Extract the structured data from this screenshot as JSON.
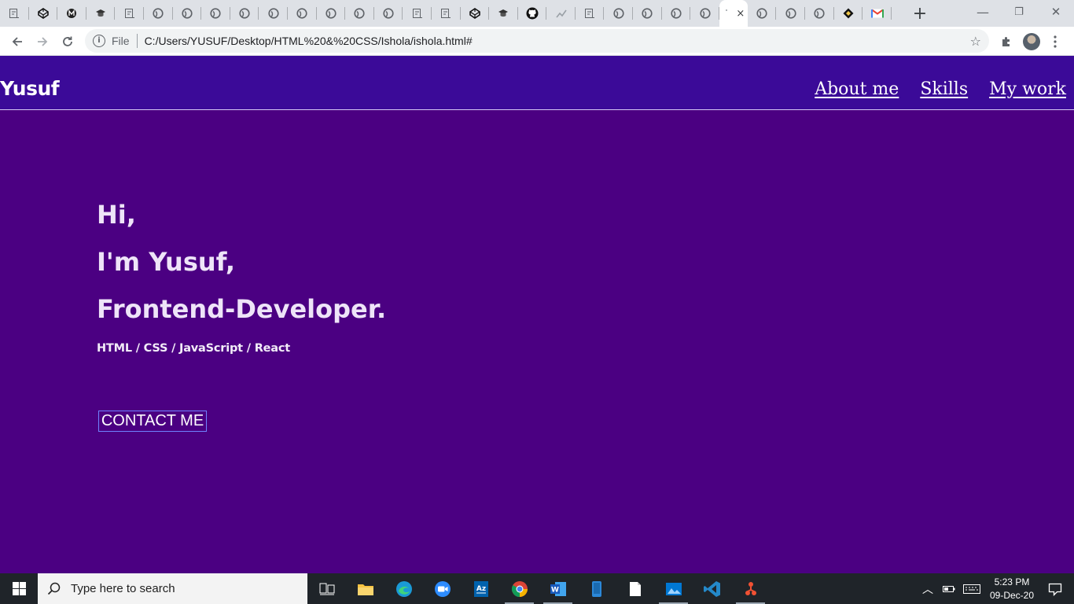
{
  "browser": {
    "window_controls": {
      "minimize": "—",
      "restore": "❐",
      "close": "✕"
    },
    "active_tab_close": "×",
    "new_tab": "+",
    "tabs": [
      {
        "icon": "doc-icon"
      },
      {
        "icon": "codepen-icon"
      },
      {
        "icon": "m-icon"
      },
      {
        "icon": "cap-icon"
      },
      {
        "icon": "doc-icon"
      },
      {
        "icon": "globe-icon"
      },
      {
        "icon": "globe-icon"
      },
      {
        "icon": "globe-icon"
      },
      {
        "icon": "globe-icon"
      },
      {
        "icon": "globe-icon"
      },
      {
        "icon": "globe-icon"
      },
      {
        "icon": "globe-icon"
      },
      {
        "icon": "globe-icon"
      },
      {
        "icon": "globe-icon"
      },
      {
        "icon": "doc-icon"
      },
      {
        "icon": "doc-icon"
      },
      {
        "icon": "codepen-icon"
      },
      {
        "icon": "cap-icon"
      },
      {
        "icon": "github-icon"
      },
      {
        "icon": "trend-icon"
      },
      {
        "icon": "doc-icon"
      },
      {
        "icon": "globe-icon"
      },
      {
        "icon": "globe-icon"
      },
      {
        "icon": "globe-icon"
      },
      {
        "icon": "globe-icon"
      },
      {
        "icon": "loading-icon",
        "active": true
      },
      {
        "icon": "globe-icon"
      },
      {
        "icon": "globe-icon"
      },
      {
        "icon": "globe-icon"
      },
      {
        "icon": "diamond-icon"
      },
      {
        "icon": "gmail-icon"
      }
    ],
    "address_bar": {
      "security_label": "File",
      "url": "C:/Users/YUSUF/Desktop/HTML%20&%20CSS/Ishola/ishola.html#"
    }
  },
  "page": {
    "brand": "Yusuf",
    "nav": [
      {
        "label": "About me"
      },
      {
        "label": "Skills"
      },
      {
        "label": "My work"
      }
    ],
    "hero": {
      "line1": "Hi,",
      "line2": "I'm Yusuf,",
      "line3": "Frontend-Developer.",
      "stack": "HTML / CSS / JavaScript / React"
    },
    "contact_button": "CONTACT ME",
    "colors": {
      "background": "#4b0082",
      "header": "#3b0a98",
      "text": "#ffffff"
    }
  },
  "taskbar": {
    "search_placeholder": "Type here to search",
    "apps": [
      "task-view-icon",
      "file-explorer-icon",
      "edge-icon",
      "zoom-icon",
      "azure-icon",
      "chrome-icon",
      "word-icon",
      "phone-icon",
      "notepad-icon",
      "photos-icon",
      "vscode-icon",
      "git-icon"
    ],
    "time": "5:23 PM",
    "date": "09-Dec-20"
  }
}
